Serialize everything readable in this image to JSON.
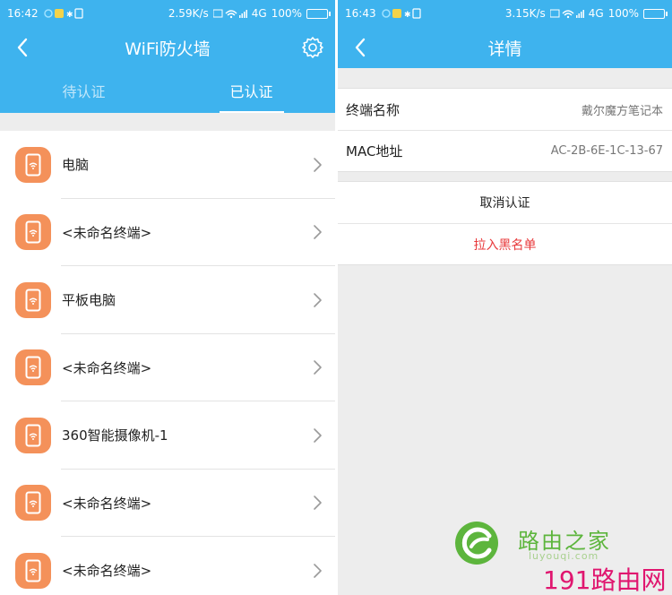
{
  "left": {
    "status": {
      "time": "16:42",
      "speed": "2.59K/s",
      "network": "4G",
      "battery": "100%"
    },
    "title": "WiFi防火墙",
    "tabs": [
      {
        "label": "待认证",
        "active": false
      },
      {
        "label": "已认证",
        "active": true
      }
    ],
    "devices": [
      {
        "name": "电脑"
      },
      {
        "name": "<未命名终端>"
      },
      {
        "name": "平板电脑"
      },
      {
        "name": "<未命名终端>"
      },
      {
        "name": "360智能摄像机-1"
      },
      {
        "name": "<未命名终端>"
      },
      {
        "name": "<未命名终端>"
      }
    ]
  },
  "right": {
    "status": {
      "time": "16:43",
      "speed": "3.15K/s",
      "network": "4G",
      "battery": "100%"
    },
    "title": "详情",
    "info": [
      {
        "label": "终端名称",
        "value": "戴尔魔方笔记本"
      },
      {
        "label": "MAC地址",
        "value": "AC-2B-6E-1C-13-67"
      }
    ],
    "actions": {
      "cancel_auth": "取消认证",
      "blacklist": "拉入黑名单"
    }
  },
  "watermark": {
    "cn": "路由之家",
    "url": "luyouqi.com",
    "brand": "191路由网"
  },
  "colors": {
    "accent": "#3eb3ee",
    "device_icon": "#f4915a",
    "danger": "#e8393b"
  },
  "icons": [
    "back-arrow-icon",
    "gear-icon",
    "phone-wifi-icon",
    "chevron-right-icon",
    "battery-icon",
    "wifi-signal-icon"
  ]
}
